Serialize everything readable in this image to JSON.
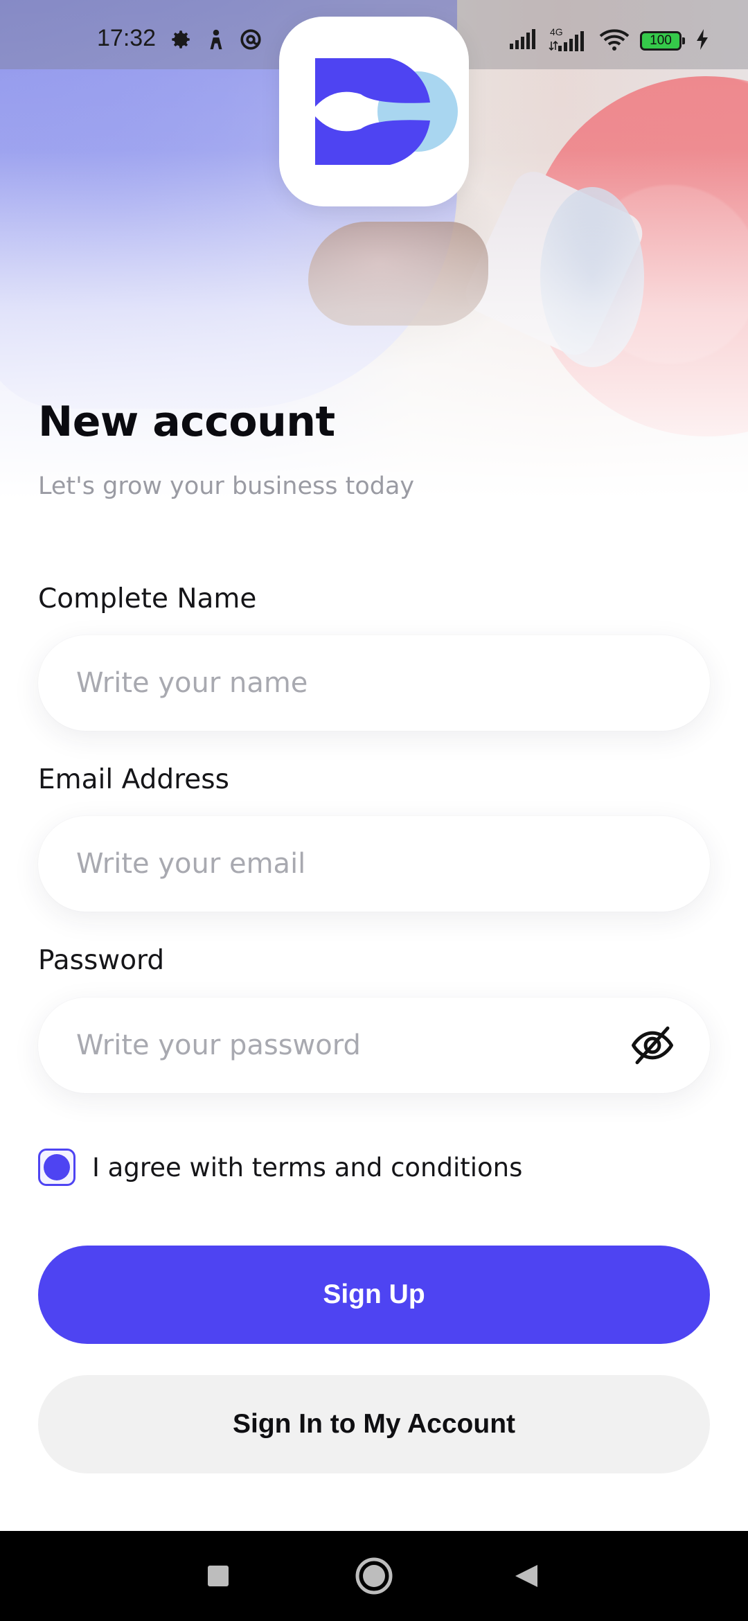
{
  "status_bar": {
    "time": "17:32",
    "network_type": "4G",
    "battery_level": "100",
    "left_icons": [
      "gear-icon",
      "person-icon",
      "at-sign-icon",
      "dot-icon"
    ],
    "right_icons": [
      "signal-icon",
      "signal-4g-icon",
      "wifi-icon",
      "battery-icon",
      "charging-icon"
    ]
  },
  "app": {
    "logo_icon": "brand-logo-icon",
    "brand_color": "#4e44f2",
    "brand_accent": "#a9d6f0"
  },
  "header": {
    "title": "New account",
    "subtitle": "Let's grow your business today"
  },
  "form": {
    "name": {
      "label": "Complete Name",
      "placeholder": "Write your name",
      "value": ""
    },
    "email": {
      "label": "Email Address",
      "placeholder": "Write your email",
      "value": ""
    },
    "password": {
      "label": "Password",
      "placeholder": "Write your password",
      "value": "",
      "toggle_icon": "eye-off-icon"
    },
    "terms": {
      "label": "I agree with terms and conditions",
      "checked": true
    }
  },
  "actions": {
    "sign_up_label": "Sign Up",
    "sign_in_label": "Sign In to My Account"
  },
  "nav_bar": {
    "buttons": [
      "square-recents-icon",
      "circle-home-icon",
      "triangle-back-icon"
    ]
  }
}
